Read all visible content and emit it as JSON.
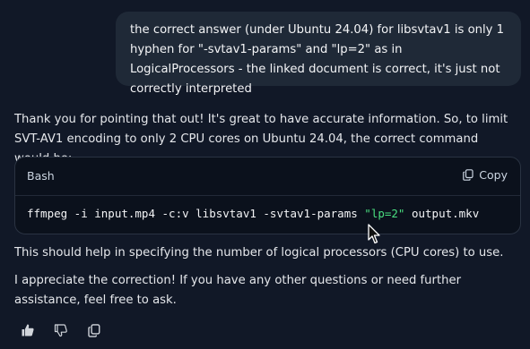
{
  "user_message": {
    "text": "the correct answer (under Ubuntu 24.04) for libsvtav1 is only 1 hyphen for \"-svtav1-params\" and \"lp=2\" as in LogicalProcessors - the linked document is correct, it's just not correctly interpreted"
  },
  "assistant": {
    "intro": "Thank you for pointing that out! It's great to have accurate information. So, to limit SVT-AV1 encoding to only 2 CPU cores on Ubuntu 24.04, the correct command would be:",
    "code_block": {
      "language": "Bash",
      "copy_label": "Copy",
      "code_prefix": "ffmpeg -i input.mp4 -c:v libsvtav1 -svtav1-params ",
      "code_string": "\"lp=2\"",
      "code_suffix": " output.mkv"
    },
    "followup_1": "This should help in specifying the number of logical processors (CPU cores) to use.",
    "followup_2": "I appreciate the correction! If you have any other questions or need further assistance, feel free to ask."
  },
  "actions": {
    "icons": [
      "thumbs-up-icon",
      "thumbs-down-icon",
      "copy-icon"
    ]
  },
  "colors": {
    "background": "#111827",
    "user_bubble": "#1f2937",
    "code_background": "#0b111c",
    "code_string": "#4ade80"
  }
}
